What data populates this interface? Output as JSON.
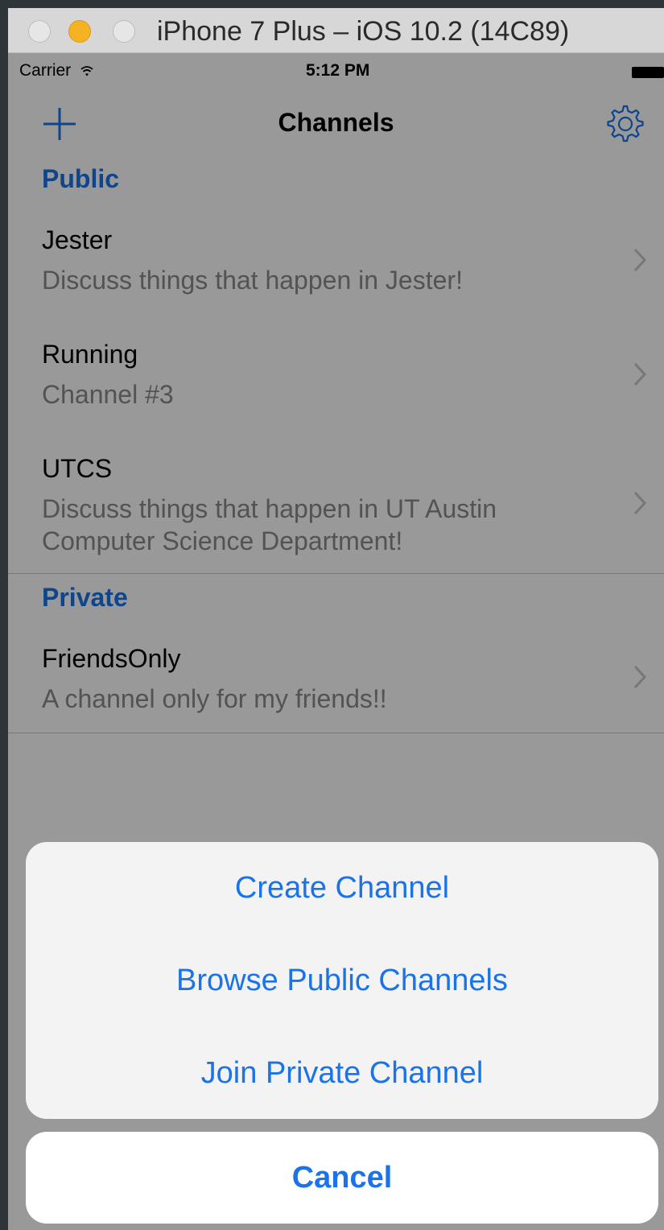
{
  "window": {
    "title": "iPhone 7 Plus – iOS 10.2 (14C89)"
  },
  "statusbar": {
    "carrier": "Carrier",
    "time": "5:12 PM"
  },
  "navbar": {
    "title": "Channels"
  },
  "sections": [
    {
      "header": "Public",
      "channels": [
        {
          "name": "Jester",
          "description": "Discuss things that happen in Jester!"
        },
        {
          "name": "Running",
          "description": "Channel #3"
        },
        {
          "name": "UTCS",
          "description": "Discuss things that happen in UT Austin Computer Science Department!"
        }
      ]
    },
    {
      "header": "Private",
      "channels": [
        {
          "name": "FriendsOnly",
          "description": "A channel only for my friends!!"
        }
      ]
    }
  ],
  "action_sheet": {
    "options": [
      "Create Channel",
      "Browse Public Channels",
      "Join Private Channel"
    ],
    "cancel_label": "Cancel"
  },
  "colors": {
    "accent": "#1a73e8",
    "subtitle": "#8a8a8a",
    "overlay": "rgba(0,0,0,0.40)"
  },
  "icons": [
    "wifi-icon",
    "battery-icon",
    "plus-icon",
    "gear-icon",
    "chevron-right-icon"
  ]
}
